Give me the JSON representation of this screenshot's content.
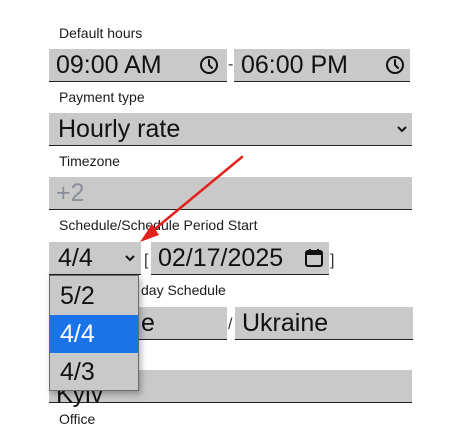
{
  "default_hours": {
    "label": "Default hours",
    "start": "09:00 AM",
    "end": "06:00 PM",
    "separator": "-"
  },
  "payment_type": {
    "label": "Payment type",
    "value": "Hourly rate"
  },
  "timezone": {
    "label": "Timezone",
    "placeholder": "+2"
  },
  "schedule": {
    "label": "Schedule/Schedule Period Start",
    "selected": "4/4",
    "bracket_open": "[",
    "bracket_close": "]",
    "date": "02/17/2025",
    "options": [
      "5/2",
      "4/4",
      "4/3"
    ]
  },
  "holiday": {
    "label_partial": "day Schedule",
    "left_partial": "e",
    "separator": "/",
    "country": "Ukraine"
  },
  "city": {
    "partial": "Kyiv"
  },
  "office": {
    "label": "Office"
  },
  "colors": {
    "field_bg": "#c9c9c9",
    "selected_option": "#1a73e8",
    "arrow": "#e3211c"
  }
}
